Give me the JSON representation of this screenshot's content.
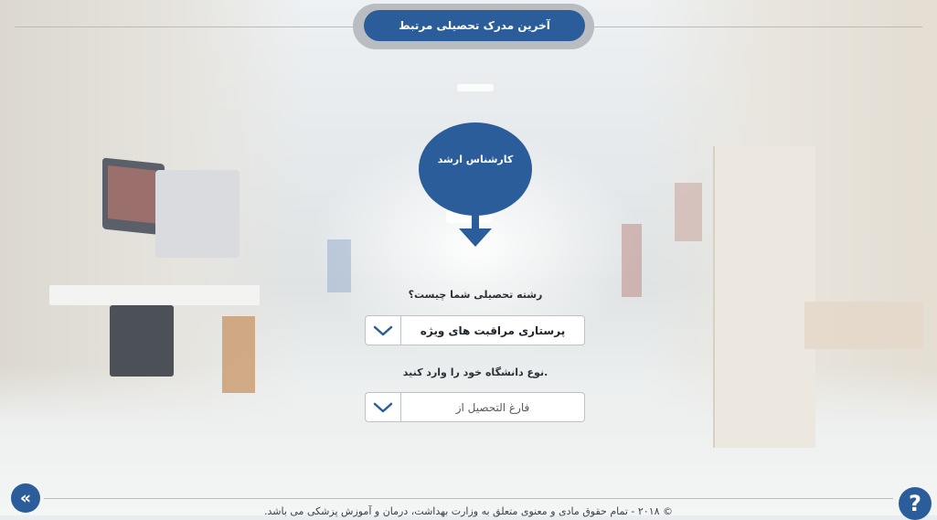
{
  "header": {
    "title": "آخرین مدرک تحصیلی مرتبط"
  },
  "degree": {
    "label": "کارشناس ارشد"
  },
  "field_question": {
    "label": "رشته تحصیلی شما چیست؟"
  },
  "field_select": {
    "value": "پرستاری مراقبت های ویژه"
  },
  "university_question": {
    "label": "نوع دانشگاه خود را وارد کنید."
  },
  "university_select": {
    "value": "فارغ التحصیل از"
  },
  "footer": {
    "copyright": "© ۲۰۱۸ - تمام حقوق مادی و معنوی متعلق به وزارت بهداشت، درمان و آموزش پزشکی می باشد.",
    "back_label": "«",
    "help_label": "?"
  },
  "colors": {
    "accent": "#2a5d99",
    "pill_border": "#b9bdc1"
  },
  "icons": {
    "back": "double-chevron-left-icon",
    "help": "question-mark-icon",
    "arrow": "arrow-down-icon",
    "dropdown": "chevron-down-icon"
  }
}
